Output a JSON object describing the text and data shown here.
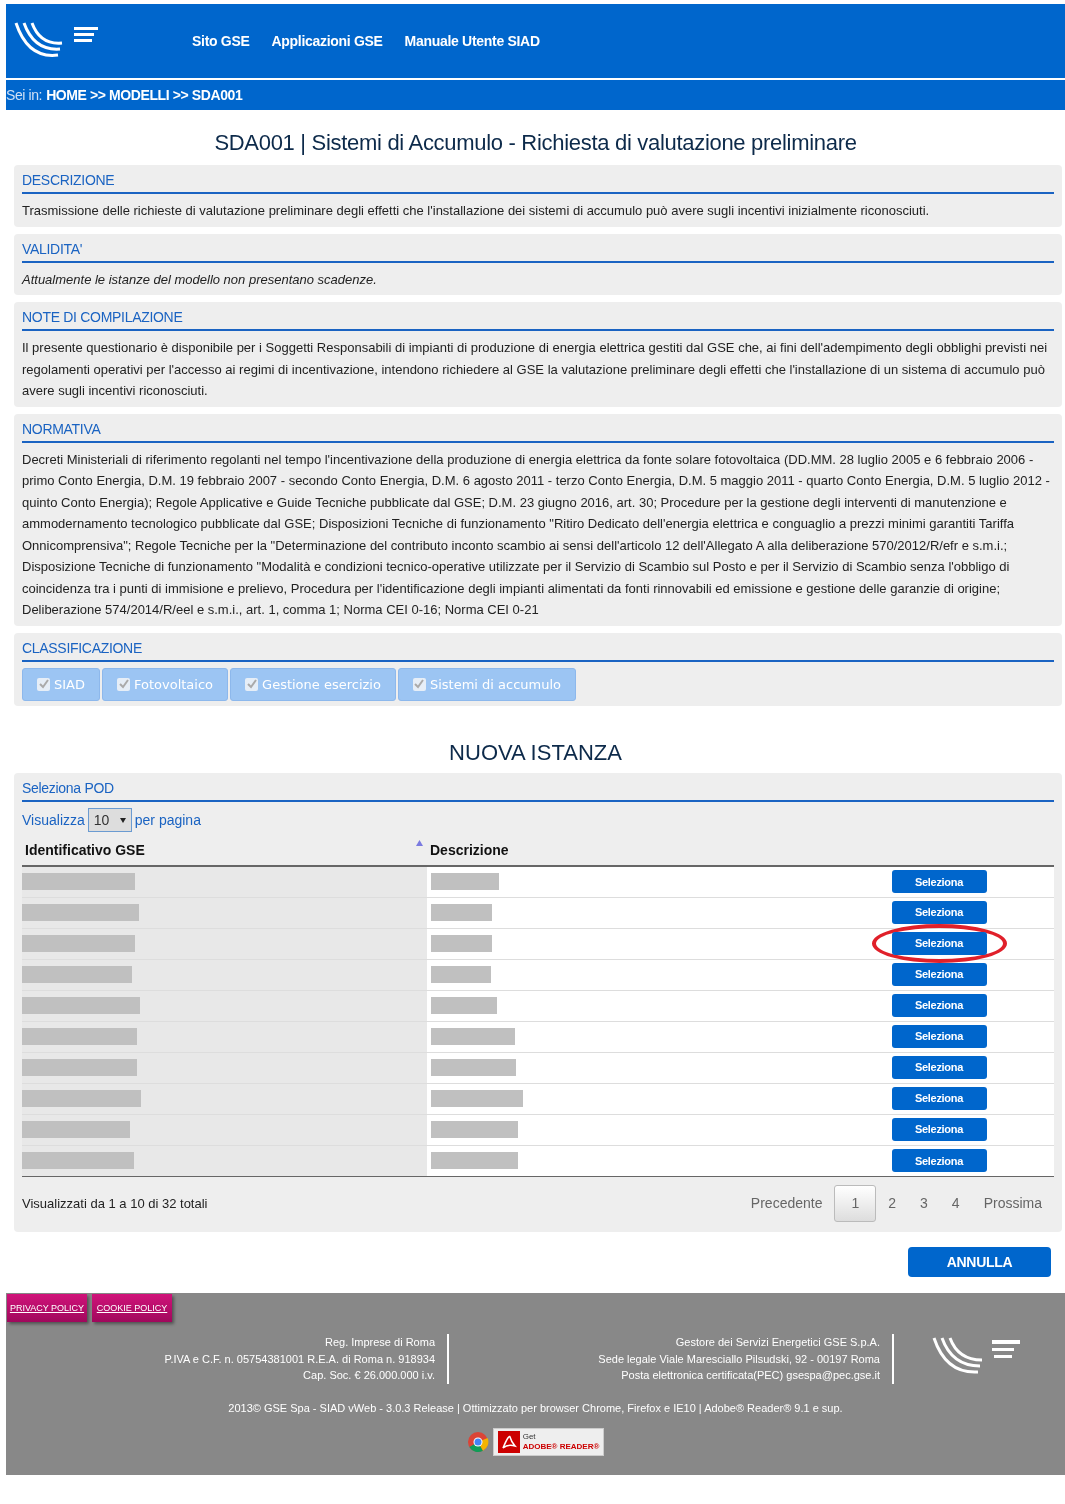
{
  "header": {
    "nav": [
      "Sito GSE",
      "Applicazioni GSE",
      "Manuale Utente SIAD"
    ]
  },
  "breadcrumb": {
    "label": "Sei in:",
    "path": "HOME >> MODELLI >> SDA001"
  },
  "title": "SDA001 | Sistemi di Accumulo - Richiesta di valutazione preliminare",
  "sections": [
    {
      "kind": "text",
      "heading": "DESCRIZIONE",
      "text": "Trasmissione delle richieste di valutazione preliminare degli effetti che l'installazione dei sistemi di accumulo può avere sugli incentivi inizialmente riconosciuti."
    },
    {
      "kind": "italic",
      "heading": "VALIDITA'",
      "text": "Attualmente le istanze del modello non presentano scadenze."
    },
    {
      "kind": "text",
      "heading": "NOTE DI COMPILAZIONE",
      "text": "Il presente questionario è disponibile per i Soggetti Responsabili di impianti di produzione di energia elettrica gestiti dal GSE che, ai fini dell'adempimento degli obblighi previsti nei regolamenti operativi per l'accesso ai regimi di incentivazione, intendono richiedere al GSE la valutazione preliminare degli effetti che l'installazione di un sistema di accumulo può avere sugli incentivi riconosciuti."
    },
    {
      "kind": "text",
      "heading": "NORMATIVA",
      "text": "Decreti Ministeriali di riferimento regolanti nel tempo l'incentivazione della produzione di energia elettrica da fonte solare fotovoltaica (DD.MM. 28 luglio 2005 e 6 febbraio 2006 - primo Conto Energia, D.M. 19 febbraio 2007 - secondo Conto Energia, D.M. 6 agosto 2011 - terzo Conto Energia, D.M. 5 maggio 2011 - quarto Conto Energia, D.M. 5 luglio 2012 - quinto Conto Energia); Regole Applicative e Guide Tecniche pubblicate dal GSE; D.M. 23 giugno 2016, art. 30; Procedure per la gestione degli interventi di manutenzione e ammodernamento tecnologico pubblicate dal GSE; Disposizioni Tecniche di funzionamento \"Ritiro Dedicato dell'energia elettrica e conguaglio a prezzi minimi garantiti Tariffa Onnicomprensiva\"; Regole Tecniche per la \"Determinazione del contributo inconto scambio ai sensi dell'articolo 12 dell'Allegato A alla deliberazione 570/2012/R/efr e s.m.i.; Disposizione Tecniche di funzionamento \"Modalità e condizioni tecnico-operative utilizzate per il Servizio di Scambio sul Posto e per il Servizio di Scambio senza l'obbligo di coincidenza tra i punti di immisione e prelievo, Procedura per l'identificazione degli impianti alimentati da fonti rinnovabili ed emissione e gestione delle garanzie di origine; Deliberazione 574/2014/R/eel e s.m.i., art. 1, comma 1; Norma CEI 0-16; Norma CEI 0-21"
    },
    {
      "kind": "tags",
      "heading": "CLASSIFICAZIONE",
      "tags": [
        {
          "label": "SIAD",
          "checked": true,
          "disabled": true
        },
        {
          "label": "Fotovoltaico",
          "checked": true,
          "disabled": true
        },
        {
          "label": "Gestione esercizio",
          "checked": true,
          "disabled": true
        },
        {
          "label": "Sistemi di accumulo",
          "checked": true,
          "disabled": true
        }
      ]
    }
  ],
  "new_instance": {
    "heading": "NUOVA ISTANZA",
    "panel_title": "Seleziona POD",
    "length": {
      "before": "Visualizza",
      "value": "10",
      "after": "per pagina"
    },
    "columns": [
      "Identificativo GSE",
      "Descrizione"
    ],
    "rows": [
      {
        "button": "Seleziona",
        "circled": false
      },
      {
        "button": "Seleziona",
        "circled": false
      },
      {
        "button": "Seleziona",
        "circled": true
      },
      {
        "button": "Seleziona",
        "circled": false
      },
      {
        "button": "Seleziona",
        "circled": false
      },
      {
        "button": "Seleziona",
        "circled": false
      },
      {
        "button": "Seleziona",
        "circled": false
      },
      {
        "button": "Seleziona",
        "circled": false
      },
      {
        "button": "Seleziona",
        "circled": false
      },
      {
        "button": "Seleziona",
        "circled": false
      }
    ],
    "info": "Visualizzati da 1 a 10 di 32 totali",
    "pagination": [
      {
        "label": "Precedente",
        "selected": false
      },
      {
        "label": "1",
        "selected": true
      },
      {
        "label": "2",
        "selected": false
      },
      {
        "label": "3",
        "selected": false
      },
      {
        "label": "4",
        "selected": false
      },
      {
        "label": "Prossima",
        "selected": false
      }
    ],
    "cancel": "ANNULLA"
  },
  "footer": {
    "policies": [
      "PRIVACY POLICY",
      "COOKIE POLICY"
    ],
    "left": [
      "Reg. Imprese di Roma",
      "P.IVA e C.F. n. 05754381001 R.E.A. di Roma n. 918934",
      "Cap. Soc. € 26.000.000 i.v."
    ],
    "right": [
      "Gestore dei Servizi Energetici GSE S.p.A.",
      "Sede legale Viale Maresciallo Pilsudski, 92 - 00197 Roma",
      "Posta elettronica certificata(PEC) gsespa@pec.gse.it"
    ],
    "copyright": "2013© GSE Spa - SIAD vWeb - 3.0.3 Release | Ottimizzato per browser Chrome, Firefox e IE10 | Adobe® Reader® 9.1 e sup.",
    "badge": {
      "top": "Get",
      "bottom": "ADOBE® READER®"
    }
  }
}
